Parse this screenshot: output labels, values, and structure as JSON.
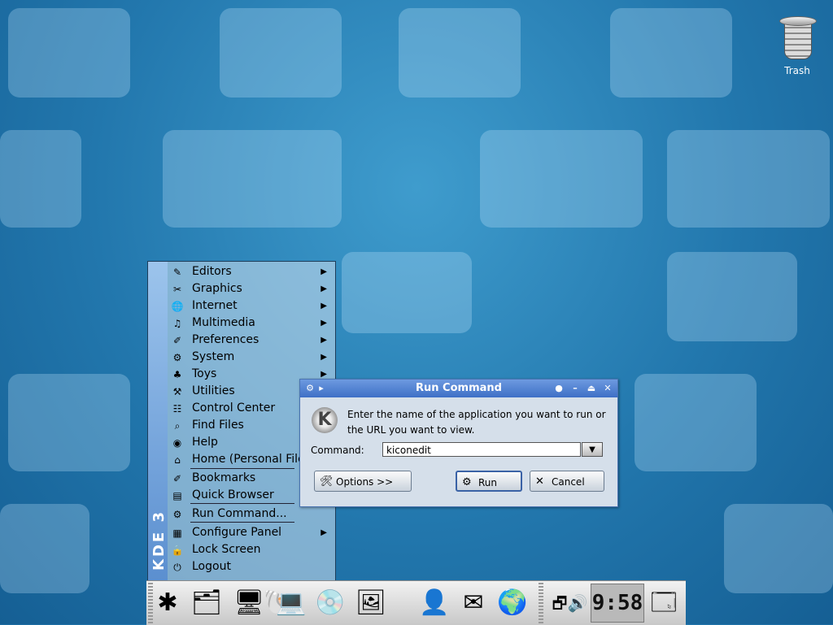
{
  "desktop": {
    "trash_label": "Trash"
  },
  "kmenu": {
    "side_label": "KDE 3",
    "items": [
      {
        "label": "Editors",
        "icon": "editors-icon",
        "submenu": true
      },
      {
        "label": "Graphics",
        "icon": "graphics-icon",
        "submenu": true
      },
      {
        "label": "Internet",
        "icon": "internet-icon",
        "submenu": true
      },
      {
        "label": "Multimedia",
        "icon": "multimedia-icon",
        "submenu": true
      },
      {
        "label": "Preferences",
        "icon": "preferences-icon",
        "submenu": true
      },
      {
        "label": "System",
        "icon": "system-icon",
        "submenu": true
      },
      {
        "label": "Toys",
        "icon": "toys-icon",
        "submenu": true
      },
      {
        "label": "Utilities",
        "icon": "utilities-icon",
        "submenu": true
      },
      {
        "label": "Control Center",
        "icon": "control-center-icon",
        "submenu": false
      },
      {
        "label": "Find Files",
        "icon": "find-files-icon",
        "submenu": false
      },
      {
        "label": "Help",
        "icon": "help-icon",
        "submenu": false
      },
      {
        "label": "Home (Personal Files)",
        "icon": "home-icon",
        "submenu": false
      },
      {
        "label": "Bookmarks",
        "icon": "bookmarks-icon",
        "submenu": true
      },
      {
        "label": "Quick Browser",
        "icon": "quick-browser-icon",
        "submenu": true
      },
      {
        "label": "Run Command...",
        "icon": "run-command-icon",
        "submenu": false
      },
      {
        "label": "Configure Panel",
        "icon": "configure-panel-icon",
        "submenu": true
      },
      {
        "label": "Lock Screen",
        "icon": "lock-icon",
        "submenu": false
      },
      {
        "label": "Logout",
        "icon": "logout-icon",
        "submenu": false
      }
    ]
  },
  "run_dialog": {
    "title": "Run Command",
    "message_line1": "Enter the name of the application you want to run or",
    "message_line2": "the URL you want to view.",
    "command_label": "Command:",
    "command_value": "kiconedit",
    "options_label": "Options >>",
    "run_label": "Run",
    "cancel_label": "Cancel"
  },
  "taskbar": {
    "clock": "9:58",
    "icons": [
      "kmenu-icon",
      "home-icon",
      "terminal-icon",
      "konqueror-shell-icon",
      "network-icon",
      "disk-icon",
      "desktop-preview-icon",
      "user-icon",
      "mail-icon",
      "globe-icon",
      "pager-icon",
      "volume-icon",
      "window-list-icon"
    ]
  },
  "colors": {
    "title_bar": "#3e6fc6",
    "desktop": "#2277ad"
  }
}
